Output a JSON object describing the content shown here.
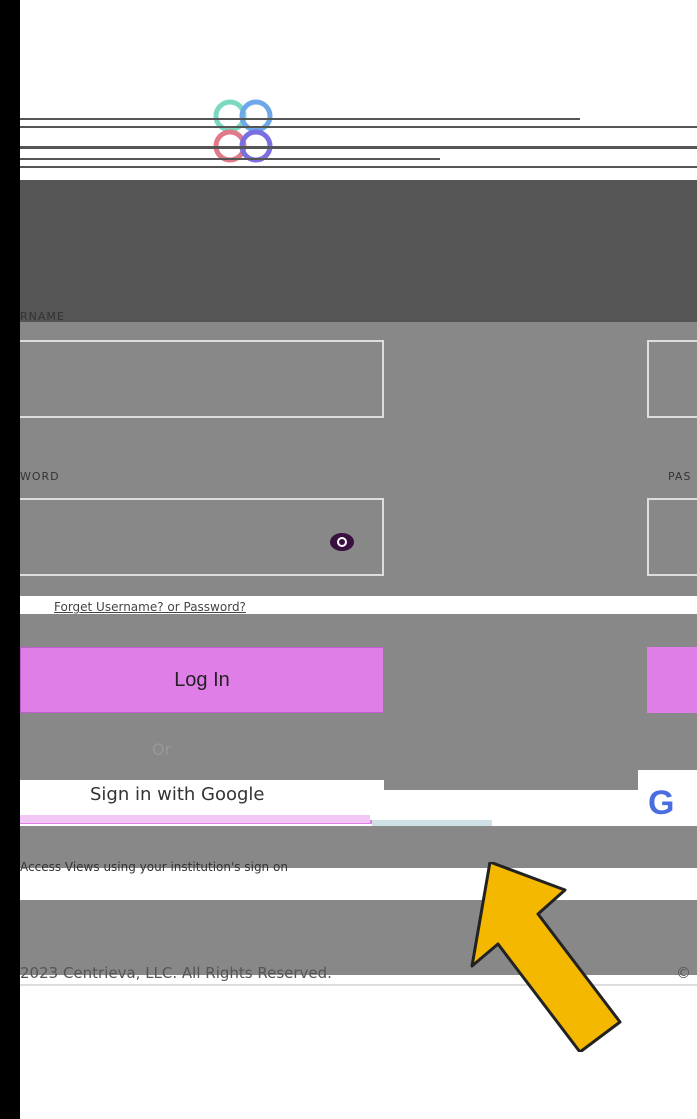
{
  "labels": {
    "username": "RNAME",
    "password": "WORD",
    "password_right": "PAS"
  },
  "links": {
    "forgot": "Forget Username? or Password?"
  },
  "buttons": {
    "login": "Log In",
    "google": "Sign in with Google"
  },
  "divider": {
    "or": "Or"
  },
  "notes": {
    "sso": "Access Views using your institution's sign on"
  },
  "footer": {
    "copyright": "2023 Centrieva, LLC. All Rights Reserved.",
    "copyright_right": "©"
  },
  "icons": {
    "eye": "eye-icon",
    "google": "google-g-icon",
    "arrow": "arrow-up-left-icon"
  },
  "colors": {
    "accent": "#e07ee8",
    "arrow": "#f5b800"
  }
}
